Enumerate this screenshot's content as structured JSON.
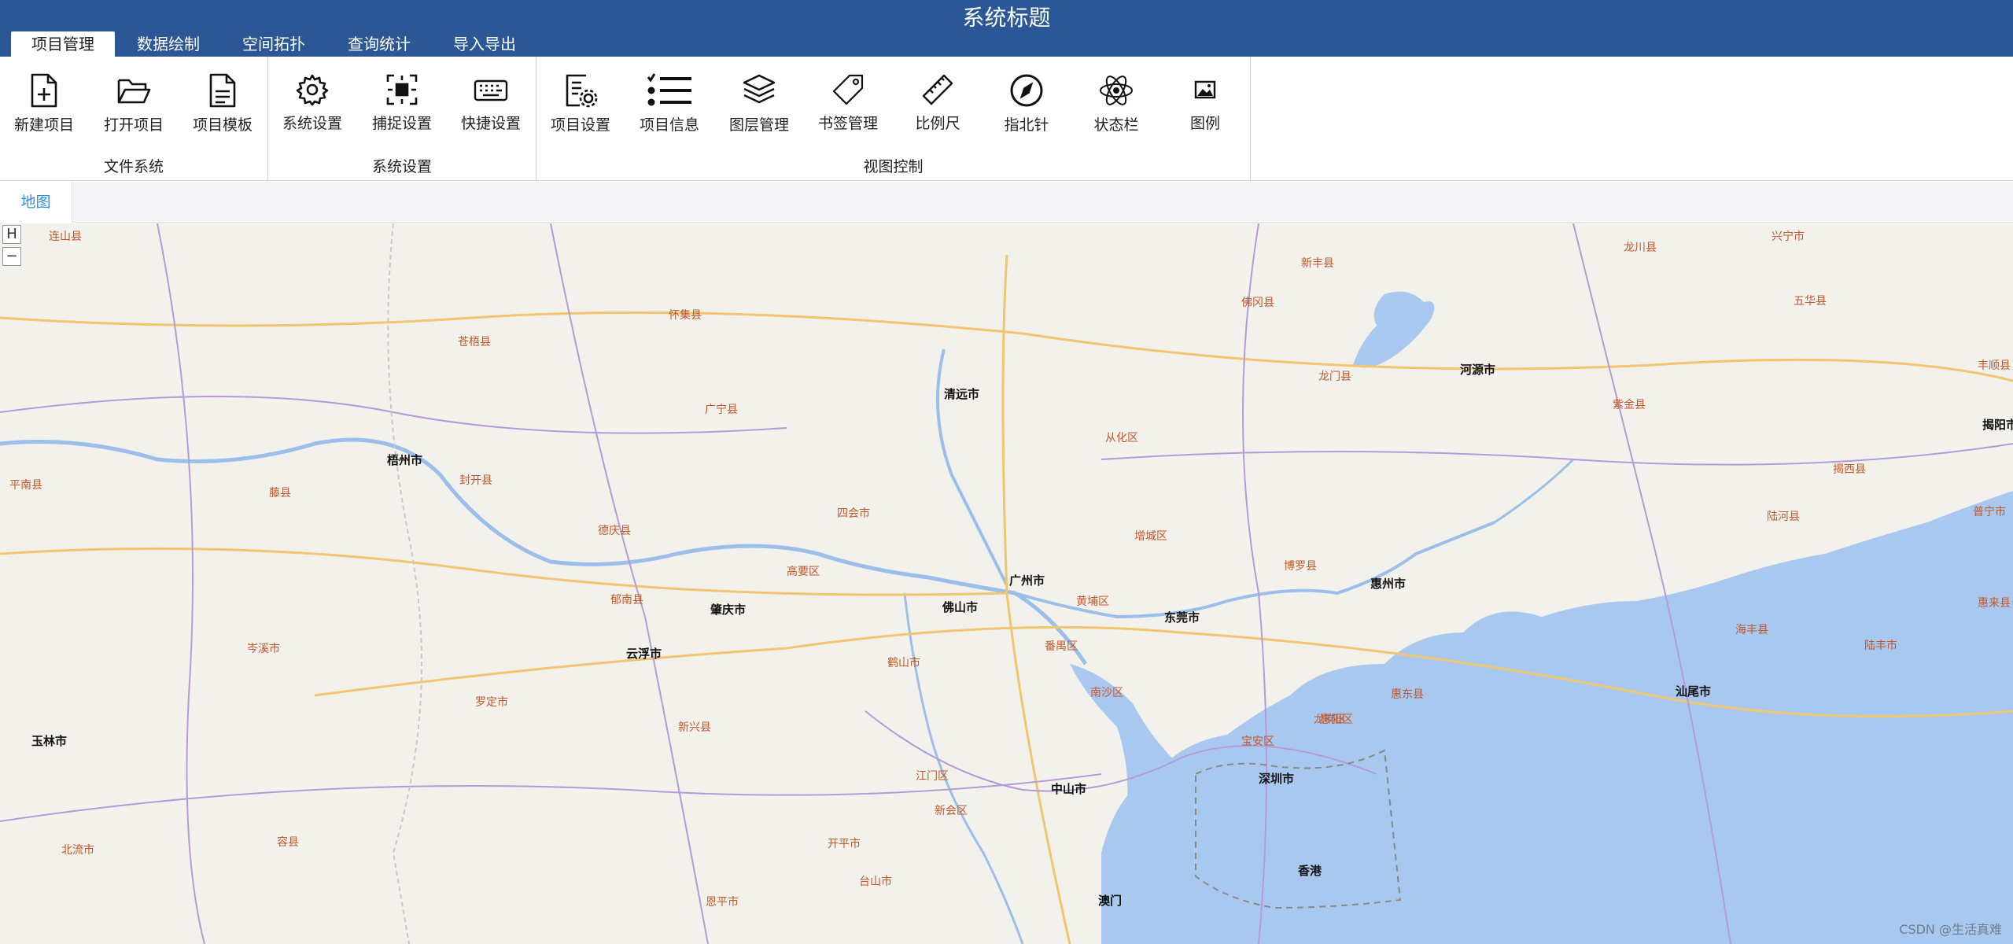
{
  "app": {
    "title": "系统标题",
    "main_tabs": [
      {
        "label": "项目管理",
        "active": true
      },
      {
        "label": "数据绘制",
        "active": false
      },
      {
        "label": "空间拓扑",
        "active": false
      },
      {
        "label": "查询统计",
        "active": false
      },
      {
        "label": "导入导出",
        "active": false
      }
    ]
  },
  "ribbon": {
    "groups": [
      {
        "label": "文件系统",
        "buttons": [
          {
            "label": "新建项目",
            "icon": "new-file-icon"
          },
          {
            "label": "打开项目",
            "icon": "open-folder-icon"
          },
          {
            "label": "项目模板",
            "icon": "template-file-icon"
          }
        ]
      },
      {
        "label": "系统设置",
        "buttons": [
          {
            "label": "系统设置",
            "icon": "gear-icon"
          },
          {
            "label": "捕捉设置",
            "icon": "snap-icon"
          },
          {
            "label": "快捷设置",
            "icon": "keyboard-icon"
          }
        ]
      },
      {
        "label": "视图控制",
        "buttons": [
          {
            "label": "项目设置",
            "icon": "project-settings-icon"
          },
          {
            "label": "项目信息",
            "icon": "list-check-icon"
          },
          {
            "label": "图层管理",
            "icon": "layers-icon"
          },
          {
            "label": "书签管理",
            "icon": "tag-icon"
          },
          {
            "label": "比例尺",
            "icon": "ruler-icon"
          },
          {
            "label": "指北针",
            "icon": "compass-icon"
          },
          {
            "label": "状态栏",
            "icon": "atom-icon"
          },
          {
            "label": "图例",
            "icon": "image-icon"
          }
        ]
      }
    ]
  },
  "doc_tabs": {
    "map_label": "地图"
  },
  "map": {
    "zoom_in_label": "H",
    "zoom_out_label": "−",
    "watermark": "CSDN @生活真难",
    "labels": {
      "guangzhou": "广州市",
      "foshan": "佛山市",
      "dongguan": "东莞市",
      "shenzhen": "深圳市",
      "hongkong": "香港",
      "macau": "澳门",
      "zhongshan": "中山市",
      "huizhou": "惠州市",
      "qingyuan": "清远市",
      "zhaoqing": "肇庆市",
      "yunfu": "云浮市",
      "wuzhou": "梧州市",
      "heyuan": "河源市",
      "shanwei": "汕尾市",
      "yulin": "玉林市",
      "jieyang": "揭阳市",
      "conghua": "从化区",
      "zengcheng": "增城区",
      "panyu": "番禺区",
      "nansha": "南沙区",
      "huangpu": "黄埔区",
      "baoan": "宝安区",
      "longgang": "龙岗区",
      "jiangmen": "江门区",
      "xinhui": "新会区",
      "sihui": "四会市",
      "gaoyao": "高要区",
      "heshan": "鹤山市",
      "kaiping": "开平市",
      "taishan": "台山市",
      "enping": "恩平市",
      "boluo": "博罗县",
      "huiyang": "惠阳区",
      "huidong": "惠东县",
      "longmen": "龙门县",
      "xinfeng": "新丰县",
      "fogang": "佛冈县",
      "guangning": "广宁县",
      "huaiji": "怀集县",
      "fengkai": "封开县",
      "deqing": "德庆县",
      "luoding": "罗定市",
      "xinxing": "新兴县",
      "yunan": "郁南县",
      "cenxi": "岑溪市",
      "zijin": "紫金县",
      "lufeng": "陆丰市",
      "haifeng": "海丰县",
      "tengxian": "藤县",
      "longchuan": "龙川县",
      "wuhua": "五华县",
      "fengshun": "丰顺县",
      "jiexi": "揭西县",
      "huilai": "惠来县",
      "puning": "普宁市",
      "luhe": "陆河县",
      "xingning": "兴宁市",
      "pingnan": "平南县",
      "cangwu": "苍梧县",
      "beiliu": "北流市",
      "rongxian": "容县",
      "lianshan": "连山县"
    }
  }
}
